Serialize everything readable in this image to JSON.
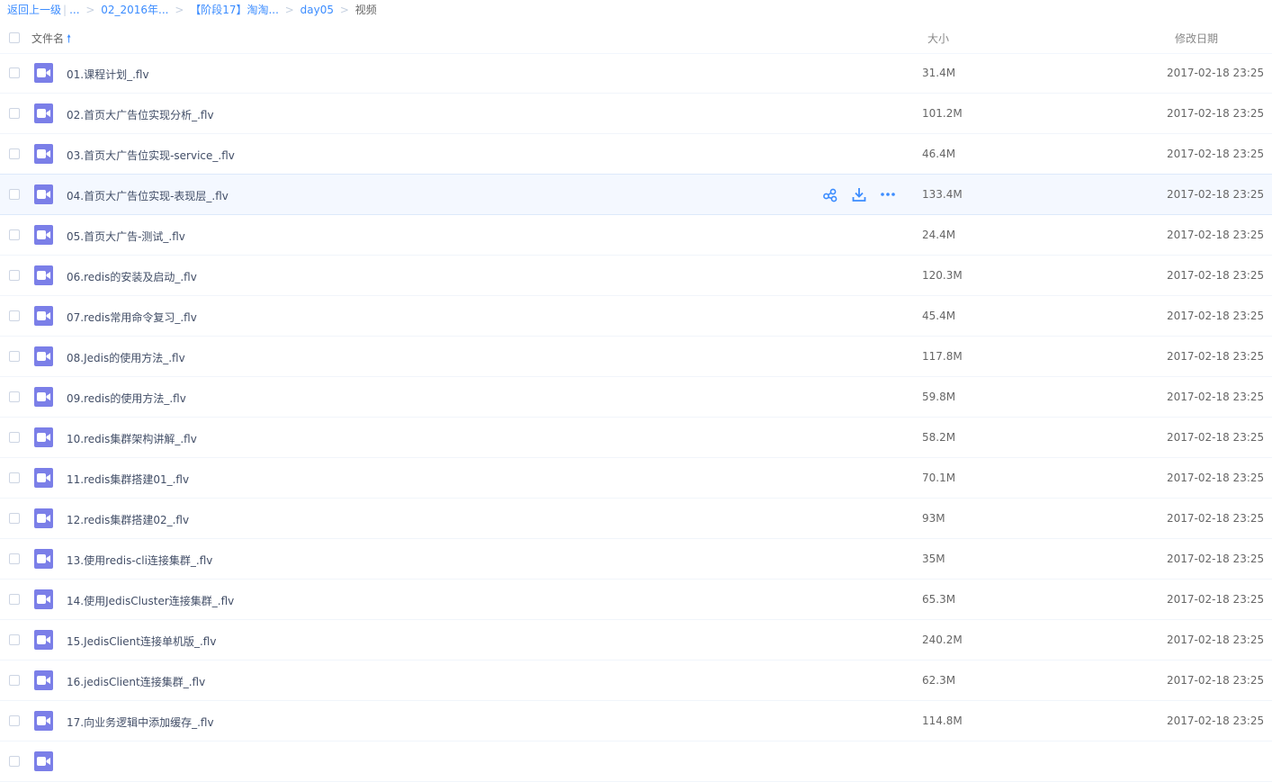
{
  "breadcrumb": {
    "back": "返回上一级",
    "ellipsis": "...",
    "crumbs": [
      "02_2016年...",
      "【阶段17】淘淘...",
      "day05"
    ],
    "current": "视频"
  },
  "header": {
    "name_label": "文件名",
    "size_label": "大小",
    "date_label": "修改日期",
    "sort_icon": "arrow-up-icon"
  },
  "colors": {
    "accent": "#3b8cff",
    "video_icon": "#7b7fe8",
    "hover_row": "#f4f8ff"
  },
  "files": [
    {
      "name": "01.课程计划_.flv",
      "size": "31.4M",
      "date": "2017-02-18 23:25"
    },
    {
      "name": "02.首页大广告位实现分析_.flv",
      "size": "101.2M",
      "date": "2017-02-18 23:25"
    },
    {
      "name": "03.首页大广告位实现-service_.flv",
      "size": "46.4M",
      "date": "2017-02-18 23:25"
    },
    {
      "name": "04.首页大广告位实现-表现层_.flv",
      "size": "133.4M",
      "date": "2017-02-18 23:25"
    },
    {
      "name": "05.首页大广告-测试_.flv",
      "size": "24.4M",
      "date": "2017-02-18 23:25"
    },
    {
      "name": "06.redis的安装及启动_.flv",
      "size": "120.3M",
      "date": "2017-02-18 23:25"
    },
    {
      "name": "07.redis常用命令复习_.flv",
      "size": "45.4M",
      "date": "2017-02-18 23:25"
    },
    {
      "name": "08.Jedis的使用方法_.flv",
      "size": "117.8M",
      "date": "2017-02-18 23:25"
    },
    {
      "name": "09.redis的使用方法_.flv",
      "size": "59.8M",
      "date": "2017-02-18 23:25"
    },
    {
      "name": "10.redis集群架构讲解_.flv",
      "size": "58.2M",
      "date": "2017-02-18 23:25"
    },
    {
      "name": "11.redis集群搭建01_.flv",
      "size": "70.1M",
      "date": "2017-02-18 23:25"
    },
    {
      "name": "12.redis集群搭建02_.flv",
      "size": "93M",
      "date": "2017-02-18 23:25"
    },
    {
      "name": "13.使用redis-cli连接集群_.flv",
      "size": "35M",
      "date": "2017-02-18 23:25"
    },
    {
      "name": "14.使用JedisCluster连接集群_.flv",
      "size": "65.3M",
      "date": "2017-02-18 23:25"
    },
    {
      "name": "15.JedisClient连接单机版_.flv",
      "size": "240.2M",
      "date": "2017-02-18 23:25"
    },
    {
      "name": "16.jedisClient连接集群_.flv",
      "size": "62.3M",
      "date": "2017-02-18 23:25"
    },
    {
      "name": "17.向业务逻辑中添加缓存_.flv",
      "size": "114.8M",
      "date": "2017-02-18 23:25"
    },
    {
      "name": "",
      "size": "",
      "date": ""
    }
  ],
  "hover_row_index": 3,
  "row_actions": [
    "share-icon",
    "download-icon",
    "more-icon"
  ]
}
